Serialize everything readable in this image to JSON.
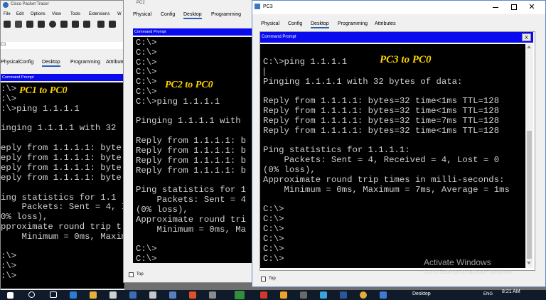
{
  "pt_window": {
    "title": "Cisco Packet Tracer",
    "menu": [
      "File",
      "Edit",
      "Options",
      "View",
      "Tools",
      "Extensions",
      "W"
    ]
  },
  "pc1": {
    "tabs": [
      "Physical",
      "Config",
      "Desktop",
      "Programming",
      "Attribute"
    ],
    "cmd_title": "Command Prompt",
    "label": "PC1 to PC0",
    "lines": [
      ":\\>",
      ":\\>",
      ":\\>ping 1.1.1.1",
      "",
      "inging 1.1.1.1 with 32",
      "",
      "eply from 1.1.1.1: byte",
      "eply from 1.1.1.1: byte",
      "eply from 1.1.1.1: byte",
      "eply from 1.1.1.1: byte",
      "",
      "ing statistics for 1.1",
      "    Packets: Sent = 4, I",
      "0% loss),",
      "pproximate round trip t",
      "    Minimum = 0ms, Maxim",
      "",
      ":\\>",
      ":\\>",
      ":\\>"
    ]
  },
  "pc2": {
    "title": "PC2",
    "tabs": [
      "Physical",
      "Config",
      "Desktop",
      "Programming"
    ],
    "cmd_title": "Command Prompt",
    "label": "PC2 to PC0",
    "lines": [
      "C:\\>",
      "C:\\>",
      "C:\\>",
      "C:\\>",
      "C:\\>",
      "C:\\>",
      "C:\\>ping 1.1.1.1",
      "",
      "Pinging 1.1.1.1 with",
      "",
      "Reply from 1.1.1.1: b",
      "Reply from 1.1.1.1: b",
      "Reply from 1.1.1.1: b",
      "Reply from 1.1.1.1: b",
      "",
      "Ping statistics for 1",
      "    Packets: Sent = 4",
      "(0% loss),",
      "Approximate round tri",
      "    Minimum = 0ms, Ma",
      "",
      "C:\\>",
      "C:\\>"
    ],
    "top_label": "Top"
  },
  "pc3": {
    "title": "PC3",
    "tabs": [
      "Physical",
      "Config",
      "Desktop",
      "Programming",
      "Attributes"
    ],
    "cmd_title": "Command Prompt",
    "close_label": "X",
    "label": "PC3 to PC0",
    "lines": [
      "C:\\>ping 1.1.1.1",
      "",
      "Pinging 1.1.1.1 with 32 bytes of data:",
      "",
      "Reply from 1.1.1.1: bytes=32 time<1ms TTL=128",
      "Reply from 1.1.1.1: bytes=32 time<1ms TTL=128",
      "Reply from 1.1.1.1: bytes=32 time=7ms TTL=128",
      "Reply from 1.1.1.1: bytes=32 time<1ms TTL=128",
      "",
      "Ping statistics for 1.1.1.1:",
      "    Packets: Sent = 4, Received = 4, Lost = 0",
      "(0% loss),",
      "Approximate round trip times in milli-seconds:",
      "    Minimum = 0ms, Maximum = 7ms, Average = 1ms",
      "",
      "C:\\>",
      "C:\\>",
      "C:\\>",
      "C:\\>",
      "C:\\>",
      "C:\\>"
    ],
    "top_label": "Top"
  },
  "watermark": {
    "line1": "Activate Windows",
    "line2": "Go to Settings to activate Windows."
  },
  "taskbar": {
    "desktop_label": "Desktop",
    "lang": "ENG",
    "time": "8:21 AM"
  }
}
